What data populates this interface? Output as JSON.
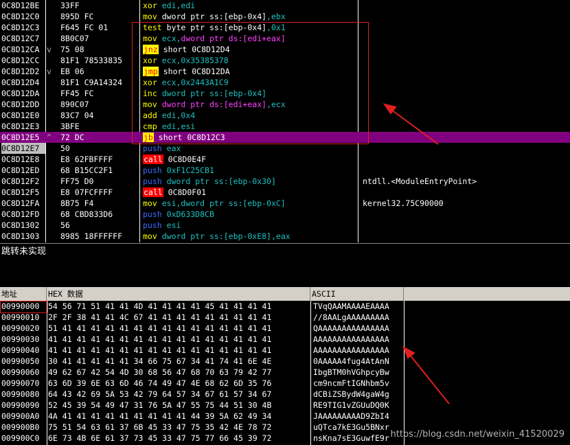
{
  "disasm": {
    "rows": [
      {
        "addr": "0C8D12BE",
        "mark": "",
        "hex": "33FF",
        "mn": "xor",
        "mnClass": "mn",
        "ops": [
          {
            "t": "edi,edi",
            "c": "op-c"
          }
        ],
        "comment": ""
      },
      {
        "addr": "0C8D12C0",
        "mark": "",
        "hex": "895D FC",
        "mn": "mov",
        "mnClass": "mn",
        "ops": [
          {
            "t": "dword ptr ss:[ebp-0x4]",
            "c": "op-w"
          },
          {
            "t": ",ebx",
            "c": "op-c"
          }
        ],
        "comment": ""
      },
      {
        "addr": "0C8D12C3",
        "mark": "",
        "hex": "F645 FC 01",
        "mn": "test",
        "mnClass": "mn",
        "ops": [
          {
            "t": "byte ptr ss:[ebp-0x4]",
            "c": "op-w"
          },
          {
            "t": ",0x1",
            "c": "op-k"
          }
        ],
        "comment": ""
      },
      {
        "addr": "0C8D12C7",
        "mark": "",
        "hex": "8B0C07",
        "mn": "mov",
        "mnClass": "mn",
        "ops": [
          {
            "t": "ecx,",
            "c": "op-c"
          },
          {
            "t": "dword ptr ds:[edi+eax]",
            "c": "op-m"
          }
        ],
        "comment": ""
      },
      {
        "addr": "0C8D12CA",
        "mark": "v",
        "hex": "75 08",
        "mn": "jnz",
        "mnClass": "mn-jcc",
        "ops": [
          {
            "t": "short 0C8D12D4",
            "c": "op-w"
          }
        ],
        "comment": ""
      },
      {
        "addr": "0C8D12CC",
        "mark": "",
        "hex": "81F1 78533835",
        "mn": "xor",
        "mnClass": "mn",
        "ops": [
          {
            "t": "ecx,",
            "c": "op-c"
          },
          {
            "t": "0x35385378",
            "c": "op-k"
          }
        ],
        "comment": ""
      },
      {
        "addr": "0C8D12D2",
        "mark": "v",
        "hex": "EB 06",
        "mn": "jmp",
        "mnClass": "mn-jcc",
        "ops": [
          {
            "t": "short 0C8D12DA",
            "c": "op-w"
          }
        ],
        "comment": ""
      },
      {
        "addr": "0C8D12D4",
        "mark": "",
        "hex": "81F1 C9A14324",
        "mn": "xor",
        "mnClass": "mn",
        "ops": [
          {
            "t": "ecx,",
            "c": "op-c"
          },
          {
            "t": "0x2443A1C9",
            "c": "op-k"
          }
        ],
        "comment": ""
      },
      {
        "addr": "0C8D12DA",
        "mark": "",
        "hex": "FF45 FC",
        "mn": "inc",
        "mnClass": "mn",
        "ops": [
          {
            "t": "dword ptr ss:[ebp-0x4]",
            "c": "op-c"
          }
        ],
        "comment": ""
      },
      {
        "addr": "0C8D12DD",
        "mark": "",
        "hex": "890C07",
        "mn": "mov",
        "mnClass": "mn",
        "ops": [
          {
            "t": "dword ptr ds:[edi+eax]",
            "c": "op-m"
          },
          {
            "t": ",ecx",
            "c": "op-c"
          }
        ],
        "comment": ""
      },
      {
        "addr": "0C8D12E0",
        "mark": "",
        "hex": "83C7 04",
        "mn": "add",
        "mnClass": "mn",
        "ops": [
          {
            "t": "edi,",
            "c": "op-c"
          },
          {
            "t": "0x4",
            "c": "op-k"
          }
        ],
        "comment": ""
      },
      {
        "addr": "0C8D12E3",
        "mark": "",
        "hex": "3BFE",
        "mn": "cmp",
        "mnClass": "mn",
        "ops": [
          {
            "t": "edi,esi",
            "c": "op-c"
          }
        ],
        "comment": ""
      },
      {
        "addr": "0C8D12E5",
        "mark": "^",
        "hex": "72 DC",
        "mn": "jb",
        "mnClass": "mn-jcc",
        "ops": [
          {
            "t": "short 0C8D12C3",
            "c": "op-w"
          }
        ],
        "comment": "",
        "selected": true
      },
      {
        "addr": "0C8D12E7",
        "mark": "",
        "hex": "50",
        "mn": "push",
        "mnClass": "mn-push",
        "ops": [
          {
            "t": "eax",
            "c": "op-c"
          }
        ],
        "comment": "",
        "current": true
      },
      {
        "addr": "0C8D12E8",
        "mark": "",
        "hex": "E8 62FBFFFF",
        "mn": "call",
        "mnClass": "mn-call",
        "ops": [
          {
            "t": "0C8D0E4F",
            "c": "op-w"
          }
        ],
        "comment": ""
      },
      {
        "addr": "0C8D12ED",
        "mark": "",
        "hex": "68 B15CC2F1",
        "mn": "push",
        "mnClass": "mn-push",
        "ops": [
          {
            "t": "0xF1C25CB1",
            "c": "op-k"
          }
        ],
        "comment": ""
      },
      {
        "addr": "0C8D12F2",
        "mark": "",
        "hex": "FF75 D0",
        "mn": "push",
        "mnClass": "mn-push",
        "ops": [
          {
            "t": "dword ptr ss:[ebp-0x30]",
            "c": "op-c"
          }
        ],
        "comment": "ntdll.<ModuleEntryPoint>"
      },
      {
        "addr": "0C8D12F5",
        "mark": "",
        "hex": "E8 07FCFFFF",
        "mn": "call",
        "mnClass": "mn-call",
        "ops": [
          {
            "t": "0C8D0F01",
            "c": "op-w"
          }
        ],
        "comment": ""
      },
      {
        "addr": "0C8D12FA",
        "mark": "",
        "hex": "8B75 F4",
        "mn": "mov",
        "mnClass": "mn",
        "ops": [
          {
            "t": "esi,dword ptr ss:[ebp-0xC]",
            "c": "op-c"
          }
        ],
        "comment": "kernel32.75C90000"
      },
      {
        "addr": "0C8D12FD",
        "mark": "",
        "hex": "68 CBD833D6",
        "mn": "push",
        "mnClass": "mn-push",
        "ops": [
          {
            "t": "0xD633D8CB",
            "c": "op-k"
          }
        ],
        "comment": ""
      },
      {
        "addr": "0C8D1302",
        "mark": "",
        "hex": "56",
        "mn": "push",
        "mnClass": "mn-push",
        "ops": [
          {
            "t": "esi",
            "c": "op-c"
          }
        ],
        "comment": ""
      },
      {
        "addr": "0C8D1303",
        "mark": "",
        "hex": "8985 18FFFFFF",
        "mn": "mov",
        "mnClass": "mn",
        "ops": [
          {
            "t": "dword ptr ss:[ebp-0xE8]",
            "c": "op-c"
          },
          {
            "t": ",eax",
            "c": "op-c"
          }
        ],
        "comment": ""
      }
    ]
  },
  "info": {
    "text": "跳转未实现"
  },
  "dump": {
    "header": {
      "addr": "地址",
      "hex": "HEX 数据",
      "ascii": "ASCII"
    },
    "rows": [
      {
        "addr": "00990000",
        "hex": "54 56 71 51 41 41 4D 41 41 41 41 45 41 41 41 41",
        "ascii": "TVqQAAMAAAAEAAAA"
      },
      {
        "addr": "00990010",
        "hex": "2F 2F 38 41 41 4C 67 41 41 41 41 41 41 41 41 41",
        "ascii": "//8AALgAAAAAAAAA"
      },
      {
        "addr": "00990020",
        "hex": "51 41 41 41 41 41 41 41 41 41 41 41 41 41 41 41",
        "ascii": "QAAAAAAAAAAAAAAA"
      },
      {
        "addr": "00990030",
        "hex": "41 41 41 41 41 41 41 41 41 41 41 41 41 41 41 41",
        "ascii": "AAAAAAAAAAAAAAAA"
      },
      {
        "addr": "00990040",
        "hex": "41 41 41 41 41 41 41 41 41 41 41 41 41 41 41 41",
        "ascii": "AAAAAAAAAAAAAAAA"
      },
      {
        "addr": "00990050",
        "hex": "30 41 41 41 41 41 34 66 75 67 34 41 74 41 6E 4E",
        "ascii": "0AAAAA4fug4AtAnN"
      },
      {
        "addr": "00990060",
        "hex": "49 62 67 42 54 4D 30 68 56 47 68 70 63 79 42 77",
        "ascii": "IbgBTM0hVGhpcyBw"
      },
      {
        "addr": "00990070",
        "hex": "63 6D 39 6E 63 6D 46 74 49 47 4E 68 62 6D 35 76",
        "ascii": "cm9ncmFtIGNhbm5v"
      },
      {
        "addr": "00990080",
        "hex": "64 43 42 69 5A 53 42 79 64 57 34 67 61 57 34 67",
        "ascii": "dCBiZSBydW4gaW4g"
      },
      {
        "addr": "00990090",
        "hex": "52 45 39 54 49 47 31 76 5A 47 55 75 44 51 30 4B",
        "ascii": "RE9TIG1vZGUuDQ0K"
      },
      {
        "addr": "009900A0",
        "hex": "4A 41 41 41 41 41 41 41 41 41 44 39 5A 62 49 34",
        "ascii": "JAAAAAAAAAD9ZbI4"
      },
      {
        "addr": "009900B0",
        "hex": "75 51 54 63 61 37 6B 45 33 47 75 35 42 4E 78 72",
        "ascii": "uQTca7kE3Gu5BNxr"
      },
      {
        "addr": "009900C0",
        "hex": "6E 73 4B 6E 61 37 73 45 33 47 75 77 66 45 39 72",
        "ascii": "nsKna7sE3GuwfE9r"
      }
    ]
  },
  "watermark": "https://blog.csdn.net/weixin_41520029",
  "colors": {
    "selected_row": "#800080",
    "annotation_red": "#e02020"
  }
}
